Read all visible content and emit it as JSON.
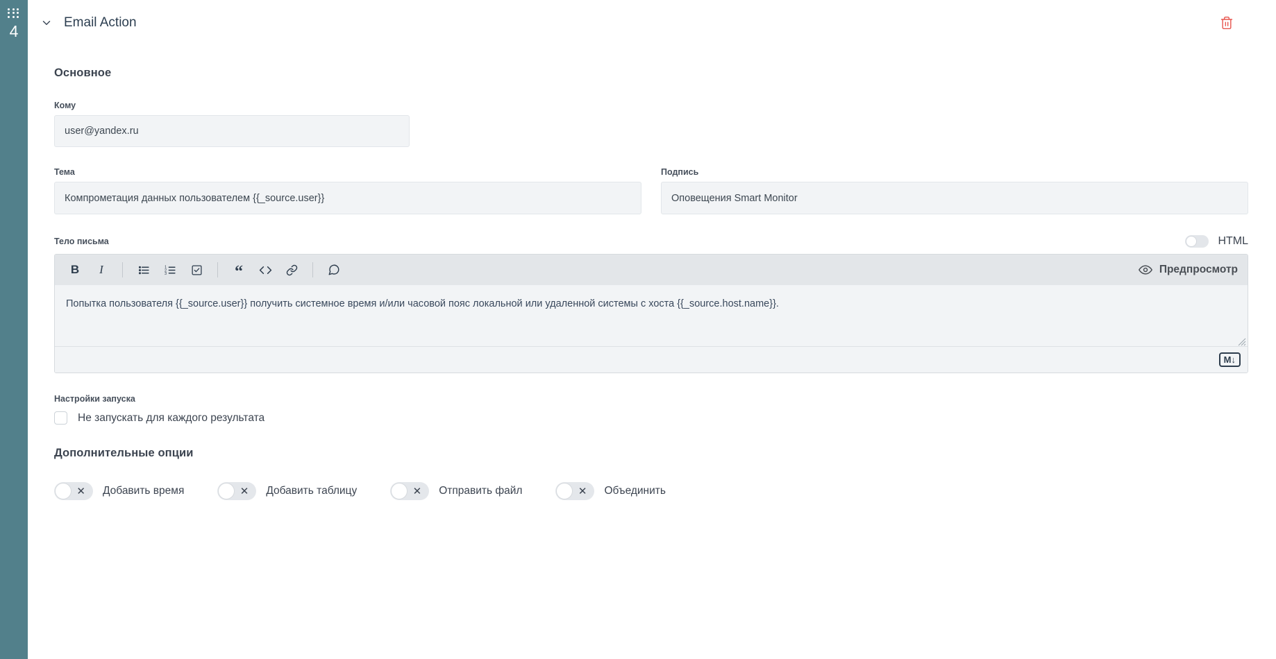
{
  "sidebar": {
    "drag_handle_icon": "drag-dots-icon",
    "step_number": "4"
  },
  "header": {
    "collapse_icon": "chevron-down-icon",
    "title": "Email Action",
    "delete_icon": "trash-icon",
    "delete_color": "#e8564f"
  },
  "main": {
    "section_basic": "Основное",
    "fields": {
      "to_label": "Кому",
      "to_value": "user@yandex.ru",
      "subject_label": "Тема",
      "subject_value": "Компрометация данных пользователем {{_source.user}}",
      "signature_label": "Подпись",
      "signature_value": "Оповещения Smart Monitor"
    },
    "body": {
      "label": "Тело письма",
      "html_toggle_label": "HTML",
      "html_toggle_state": "off",
      "toolbar": [
        {
          "name": "bold-icon",
          "glyph": "B"
        },
        {
          "name": "italic-icon",
          "glyph": "I"
        },
        {
          "name": "bullet-list-icon",
          "glyph": ""
        },
        {
          "name": "ordered-list-icon",
          "glyph": ""
        },
        {
          "name": "checkbox-list-icon",
          "glyph": ""
        },
        {
          "name": "quote-icon",
          "glyph": "“"
        },
        {
          "name": "code-icon",
          "glyph": "</>"
        },
        {
          "name": "link-icon",
          "glyph": ""
        },
        {
          "name": "comment-icon",
          "glyph": ""
        }
      ],
      "preview_label": "Предпросмотр",
      "preview_icon": "eye-icon",
      "text": "Попытка пользователя {{_source.user}} получить системное время и/или часовой пояс локальной или удаленной системы с хоста {{_source.host.name}}.",
      "markdown_badge": "M",
      "markdown_badge_arrow": "↓"
    },
    "launch": {
      "title": "Настройки запуска",
      "checkbox_label": "Не запускать для каждого результата",
      "checkbox_state": "unchecked"
    },
    "additional": {
      "title": "Дополнительные опции",
      "options": [
        {
          "label": "Добавить время",
          "state": "off",
          "mark": "✕"
        },
        {
          "label": "Добавить таблицу",
          "state": "off",
          "mark": "✕"
        },
        {
          "label": "Отправить файл",
          "state": "off",
          "mark": "✕"
        },
        {
          "label": "Объединить",
          "state": "off",
          "mark": "✕"
        }
      ]
    }
  },
  "colors": {
    "sidebar": "#52808b",
    "input_bg": "#f2f4f6",
    "toolbar_bg": "#e3e6e9",
    "accent_text": "#2c3e50"
  }
}
